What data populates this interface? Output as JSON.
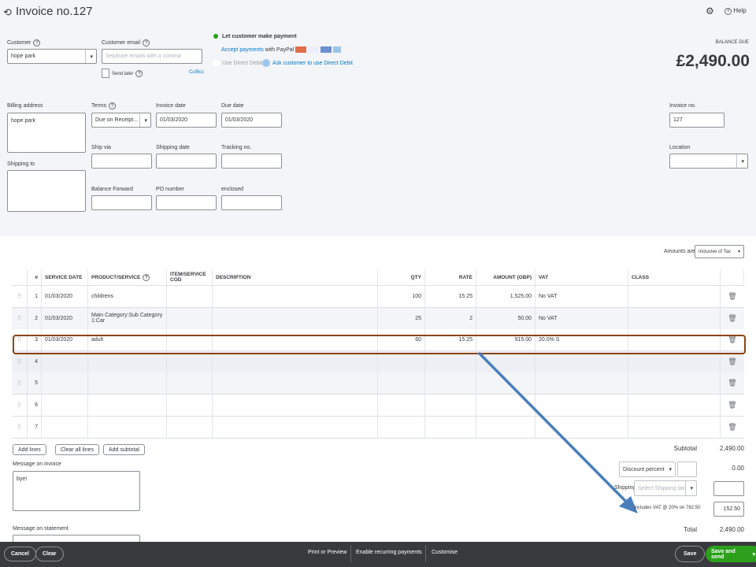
{
  "header": {
    "title": "Invoice no.127",
    "help": "Help"
  },
  "customer": {
    "label": "Customer",
    "value": "hope park"
  },
  "email": {
    "label": "Customer email",
    "placeholder": "Separate emails with a comma",
    "send_later": "Send later",
    "cc_bcc": "Cc/Bcc"
  },
  "payment": {
    "let_pay": "Let customer make payment",
    "accept": "Accept payments",
    "with_paypal": "with PayPal",
    "direct_debit": "Use Direct Debit",
    "ask_dd": "Ask customer to use Direct Debit"
  },
  "balance": {
    "label": "BALANCE DUE",
    "value": "£2,490.00"
  },
  "billing": {
    "label": "Billing address",
    "value": "hope park"
  },
  "shipping_to": {
    "label": "Shipping to"
  },
  "terms": {
    "label": "Terms",
    "value": "Due on Receipt..."
  },
  "invoice_date": {
    "label": "Invoice date",
    "value": "01/03/2020"
  },
  "due_date": {
    "label": "Due date",
    "value": "01/03/2020"
  },
  "ship_via": {
    "label": "Ship via"
  },
  "shipping_date": {
    "label": "Shipping date"
  },
  "tracking": {
    "label": "Tracking no."
  },
  "balance_forward": {
    "label": "Balance Forward"
  },
  "po": {
    "label": "PO number"
  },
  "enclosed": {
    "label": "enclosed"
  },
  "invoice_no": {
    "label": "Invoice no.",
    "value": "127"
  },
  "location": {
    "label": "Location"
  },
  "amounts_are": {
    "label": "Amounts are",
    "value": "Inclusive of Tax"
  },
  "table": {
    "headers": [
      "#",
      "SERVICE DATE",
      "PRODUCT/SERVICE",
      "ITEM/SERVICE COD",
      "DESCRIPTION",
      "QTY",
      "RATE",
      "AMOUNT (GBP)",
      "VAT",
      "CLASS"
    ],
    "rows": [
      {
        "n": "1",
        "date": "01/03/2020",
        "product": "childrens",
        "qty": "100",
        "rate": "15.25",
        "amount": "1,525.00",
        "vat": "No VAT"
      },
      {
        "n": "2",
        "date": "01/03/2020",
        "product": "Main Category:Sub Category 1:Car",
        "qty": "25",
        "rate": "2",
        "amount": "50.00",
        "vat": "No VAT"
      },
      {
        "n": "3",
        "date": "01/03/2020",
        "product": "adult",
        "qty": "60",
        "rate": "15.25",
        "amount": "915.00",
        "vat": "20.0% S"
      },
      {
        "n": "4"
      },
      {
        "n": "5"
      },
      {
        "n": "6"
      },
      {
        "n": "7"
      }
    ]
  },
  "buttons": {
    "add_lines": "Add lines",
    "clear_all": "Clear all lines",
    "add_subtotal": "Add subtotal"
  },
  "message_invoice": {
    "label": "Message on invoice",
    "value": "bye!"
  },
  "message_statement": {
    "label": "Message on statement"
  },
  "totals": {
    "subtotal_label": "Subtotal",
    "subtotal": "2,490.00",
    "discount_type": "Discount percent",
    "discount": "0.00",
    "shipping_label": "Shipping",
    "shipping_tax_placeholder": "Select Shipping tax",
    "vat_label": "Includes VAT @ 20% on 762.50",
    "vat": "152.50",
    "total_label": "Total",
    "total": "2,490.00"
  },
  "footer": {
    "cancel": "Cancel",
    "clear": "Clear",
    "print": "Print or Preview",
    "recurring": "Enable recurring payments",
    "customise": "Customise",
    "save": "Save",
    "save_send": "Save and send"
  },
  "colors": {
    "accent_green": "#2ca01c",
    "link": "#0077c5",
    "highlight": "#8b4513",
    "arrow": "#4a7ebb"
  }
}
